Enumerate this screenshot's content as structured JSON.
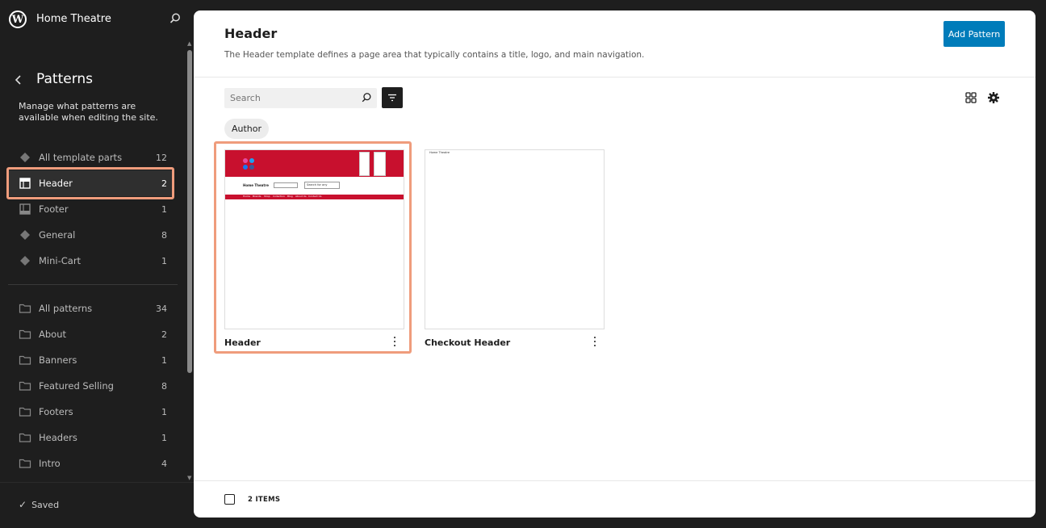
{
  "site": {
    "title": "Home Theatre"
  },
  "sidebar": {
    "section_title": "Patterns",
    "description": "Manage what patterns are available when editing the site.",
    "template_parts": [
      {
        "label": "All template parts",
        "count": "12",
        "icon": "diamond-icon"
      },
      {
        "label": "Header",
        "count": "2",
        "icon": "header-icon",
        "active": true
      },
      {
        "label": "Footer",
        "count": "1",
        "icon": "footer-icon"
      },
      {
        "label": "General",
        "count": "8",
        "icon": "diamond-icon"
      },
      {
        "label": "Mini-Cart",
        "count": "1",
        "icon": "diamond-icon"
      }
    ],
    "categories": [
      {
        "label": "All patterns",
        "count": "34",
        "icon": "folder-icon"
      },
      {
        "label": "About",
        "count": "2",
        "icon": "folder-icon"
      },
      {
        "label": "Banners",
        "count": "1",
        "icon": "folder-icon"
      },
      {
        "label": "Featured Selling",
        "count": "8",
        "icon": "folder-icon"
      },
      {
        "label": "Footers",
        "count": "1",
        "icon": "folder-icon"
      },
      {
        "label": "Headers",
        "count": "1",
        "icon": "folder-icon"
      },
      {
        "label": "Intro",
        "count": "4",
        "icon": "folder-icon"
      }
    ],
    "status": "Saved"
  },
  "main": {
    "title": "Header",
    "description": "The Header template defines a page area that typically contains a title, logo, and main navigation.",
    "add_button": "Add Pattern",
    "search_placeholder": "Search",
    "filter_chip": "Author",
    "cards": [
      {
        "title": "Header",
        "preview": {
          "site_title": "Home Theatre",
          "search_placeholder": "Search for any",
          "nav_items": [
            "Home",
            "Brands",
            "Shop",
            "Collection",
            "Blog",
            "About Us",
            "Contact Us"
          ]
        }
      },
      {
        "title": "Checkout Header",
        "preview": {
          "site_title": "Home Theatre"
        }
      }
    ],
    "items_count": "2 ITEMS"
  },
  "colors": {
    "accent": "#007cba",
    "highlight": "#ef9c7c",
    "preview_red": "#c8102e",
    "sidebar_bg": "#1e1e1e"
  }
}
